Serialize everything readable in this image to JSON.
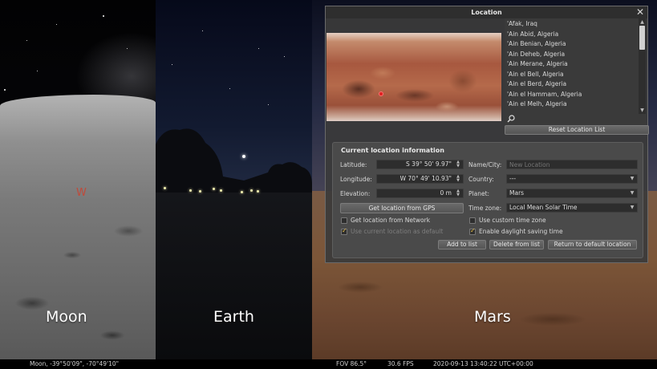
{
  "panels": {
    "moon_label": "Moon",
    "earth_label": "Earth",
    "mars_label": "Mars",
    "moon_compass": "W"
  },
  "statusbar": {
    "location": "Moon, -39°50'09\", -70°49'10\"",
    "fov": "FOV 86.5°",
    "fps": "30.6 FPS",
    "datetime": "2020-09-13 13:40:22 UTC+00:00"
  },
  "dialog": {
    "title": "Location",
    "cities": [
      "'Afak, Iraq",
      "'Ain Abid, Algeria",
      "'Ain Benian, Algeria",
      "'Ain Deheb, Algeria",
      "'Ain Merane, Algeria",
      "'Ain el Bell, Algeria",
      "'Ain el Berd, Algeria",
      "'Ain el Hammam, Algeria",
      "'Ain el Melh, Algeria"
    ],
    "search_value": "",
    "reset_button": "Reset Location List",
    "info_title": "Current location information",
    "latitude_label": "Latitude:",
    "latitude_value": "S 39° 50' 9.97\"",
    "longitude_label": "Longitude:",
    "longitude_value": "W 70° 49' 10.93\"",
    "elevation_label": "Elevation:",
    "elevation_value": "0 m",
    "gps_button": "Get location from GPS",
    "network_checkbox": "Get location from Network",
    "default_checkbox": "Use current location as default",
    "name_label": "Name/City:",
    "name_placeholder": "New Location",
    "country_label": "Country:",
    "country_value": "---",
    "planet_label": "Planet:",
    "planet_value": "Mars",
    "timezone_label": "Time zone:",
    "timezone_value": "Local Mean Solar Time",
    "custom_tz_checkbox": "Use custom time zone",
    "dst_checkbox": "Enable daylight saving time",
    "add_button": "Add to list",
    "delete_button": "Delete from list",
    "return_button": "Return to default location",
    "network_checked": false,
    "default_checked": true,
    "custom_tz_checked": false,
    "dst_checked": true
  }
}
